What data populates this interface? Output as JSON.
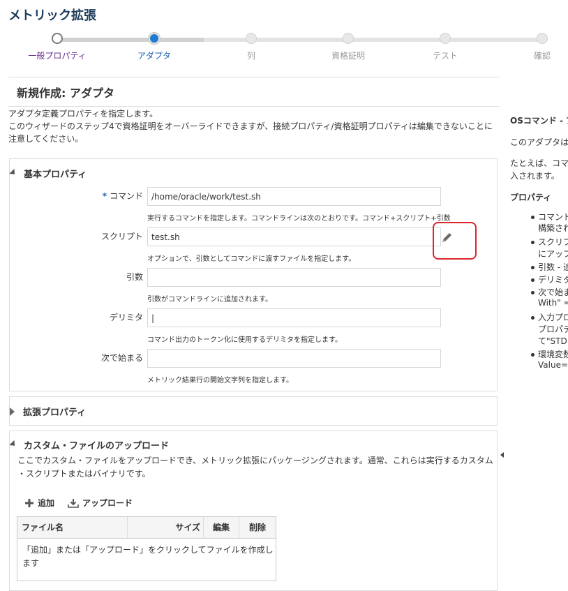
{
  "page_title": "メトリック拡張",
  "train": {
    "steps": [
      {
        "label": "一般プロパティ",
        "state": "visited"
      },
      {
        "label": "アダプタ",
        "state": "current"
      },
      {
        "label": "列",
        "state": "future"
      },
      {
        "label": "資格証明",
        "state": "future"
      },
      {
        "label": "テスト",
        "state": "future"
      },
      {
        "label": "確認",
        "state": "future"
      }
    ]
  },
  "section_title": "新規作成: アダプタ",
  "intro": {
    "line1": "アダプタ定義プロパティを指定します。",
    "line2": "このウィザードのステップ4で資格証明をオーバーライドできますが、接続プロパティ/資格証明プロパティは編集できないことに",
    "line3": "注意してください。"
  },
  "basic_props": {
    "header": "基本プロパティ",
    "required_mark": "*",
    "command": {
      "label": "コマンド",
      "value": "/home/oracle/work/test.sh",
      "hint": "実行するコマンドを指定します。コマンドラインは次のとおりです。コマンド+スクリプト+引数"
    },
    "script": {
      "label": "スクリプト",
      "value": "test.sh",
      "hint": "オプションで、引数としてコマンドに渡すファイルを指定します。"
    },
    "args": {
      "label": "引数",
      "value": "",
      "hint": "引数がコマンドラインに追加されます。"
    },
    "delimiter": {
      "label": "デリミタ",
      "value": "|",
      "hint": "コマンド出力のトークン化に使用するデリミタを指定します。"
    },
    "starts_with": {
      "label": "次で始まる",
      "value": "",
      "hint": "メトリック結果行の開始文字列を指定します。"
    }
  },
  "extended_props": {
    "header": "拡張プロパティ"
  },
  "custom_upload": {
    "header": "カスタム・ファイルのアップロード",
    "desc_line1": "ここでカスタム・ファイルをアップロードでき、メトリック拡張にパッケージングされます。通常、これらは実行するカスタム",
    "desc_line2": "・スクリプトまたはバイナリです。",
    "add_label": "追加",
    "upload_label": "アップロード",
    "columns": {
      "filename": "ファイル名",
      "size": "サイズ",
      "edit": "編集",
      "delete": "削除"
    },
    "empty_line1": "「追加」または「アップロード」をクリックしてファイルを作成し",
    "empty_line2": "ます"
  },
  "right_panel": {
    "title": "OSコマンド - ア",
    "p1": "このアダプタは",
    "p2a": "たとえば、コマ",
    "p2b": "入されます。",
    "props_title": "プロパティ",
    "bullets": [
      "コマンド",
      "構築され",
      "スクリプ",
      "にアップ",
      "引数 - 追",
      "デリミタ",
      "次で始ま",
      "With\" =",
      "入力プロ",
      "プロパテ",
      "て\"STD",
      "環境変数",
      "Value="
    ]
  },
  "colors": {
    "accent": "#1f7bd1",
    "title": "#1c3a5a",
    "highlight": "#d9262b"
  }
}
